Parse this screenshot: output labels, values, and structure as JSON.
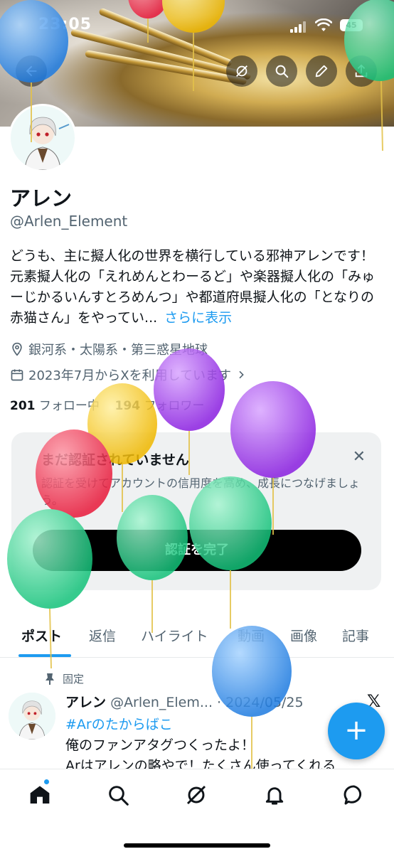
{
  "status_bar": {
    "time": "23:05",
    "battery": "45"
  },
  "header": {
    "icons": [
      "back-arrow-icon",
      "grok-icon",
      "search-icon",
      "edit-icon",
      "share-icon"
    ]
  },
  "profile": {
    "name": "アレン",
    "handle": "@Arlen_Element",
    "bio": "どうも、主に擬人化の世界を横行している邪神アレンです！元素擬人化の「えれめんとわーるど」や楽器擬人化の「みゅーじかるいんすとろめんつ」や都道府県擬人化の「となりの赤猫さん」をやってい...",
    "show_more": "さらに表示",
    "location": "銀河系・太陽系・第三惑星地球",
    "joined": "2023年7月からXを利用しています",
    "following_count": "201",
    "following_label": "フォロー中",
    "followers_count": "194",
    "followers_label": "フォロワー"
  },
  "verify_card": {
    "title": "まだ認証されていません",
    "body": "認証を受けてアカウントの信用度を高め、成長につなげましょう。",
    "button": "認証を完了"
  },
  "tabs": [
    "ポスト",
    "返信",
    "ハイライト",
    "動画",
    "画像",
    "記事"
  ],
  "active_tab": "ポスト",
  "pinned_post": {
    "pinned_label": "固定",
    "author": "アレン",
    "handle_date": "@Arlen_Elem... · 2024/05/25",
    "hashtag": "#Arのたからばこ",
    "text_line1": "俺のファンアタグつくったよ！",
    "text_line2": "Arはアレンの略やで！たくさん使ってくれる"
  },
  "fab": {
    "label": "+"
  },
  "bottom_nav": [
    "home-icon",
    "search-icon",
    "grok-icon",
    "notifications-icon",
    "messages-icon"
  ],
  "colors": {
    "accent": "#1d9bf0",
    "text": "#0f1419",
    "muted": "#536471",
    "card_bg": "#eff1f2"
  }
}
